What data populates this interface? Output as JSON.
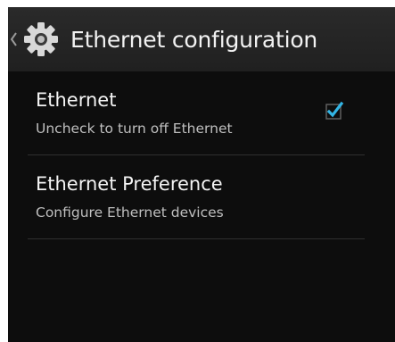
{
  "action_bar": {
    "title": "Ethernet configuration",
    "back_icon": "chevron-left-icon",
    "app_icon": "gear-icon"
  },
  "preferences": [
    {
      "title": "Ethernet",
      "summary": "Uncheck to turn off Ethernet",
      "checked": true
    },
    {
      "title": "Ethernet Preference",
      "summary": "Configure Ethernet devices"
    }
  ],
  "colors": {
    "background": "#0d0d0d",
    "action_bar": "#242424",
    "accent": "#33b5e5",
    "title_text": "#f2f2f2",
    "summary_text": "#bfbfbf"
  }
}
